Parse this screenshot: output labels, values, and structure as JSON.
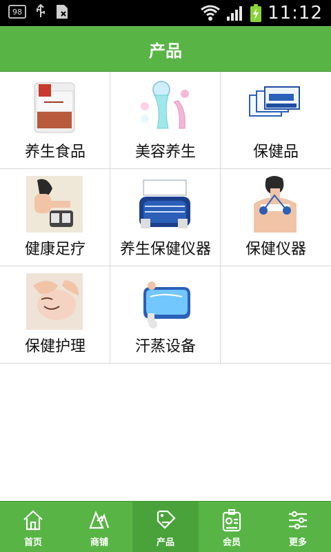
{
  "status": {
    "badge": "98",
    "clock": "11:12",
    "usb_icon": "usb-icon",
    "sim_icon": "sim-card-icon",
    "wifi_icon": "wifi-icon",
    "signal_icon": "signal-icon",
    "battery_icon": "battery-icon"
  },
  "header": {
    "title": "产品"
  },
  "categories": [
    {
      "label": "养生食品",
      "image": "health-food-product-image"
    },
    {
      "label": "美容养生",
      "image": "beauty-massage-device-image"
    },
    {
      "label": "保健品",
      "image": "health-supplement-box-image"
    },
    {
      "label": "健康足疗",
      "image": "foot-massager-image"
    },
    {
      "label": "养生保健仪器",
      "image": "health-device-image"
    },
    {
      "label": "保健仪器",
      "image": "neck-massager-image"
    },
    {
      "label": "保健护理",
      "image": "facial-care-image"
    },
    {
      "label": "汗蒸设备",
      "image": "sauna-equipment-image"
    }
  ],
  "tabs": [
    {
      "label": "首页",
      "icon": "home-icon"
    },
    {
      "label": "商铺",
      "icon": "map-pin-icon"
    },
    {
      "label": "产品",
      "icon": "sale-tag-icon"
    },
    {
      "label": "会员",
      "icon": "member-card-icon"
    },
    {
      "label": "更多",
      "icon": "sliders-icon"
    }
  ],
  "colors": {
    "accent": "#58b545",
    "grid_line": "#d7d7d7"
  }
}
